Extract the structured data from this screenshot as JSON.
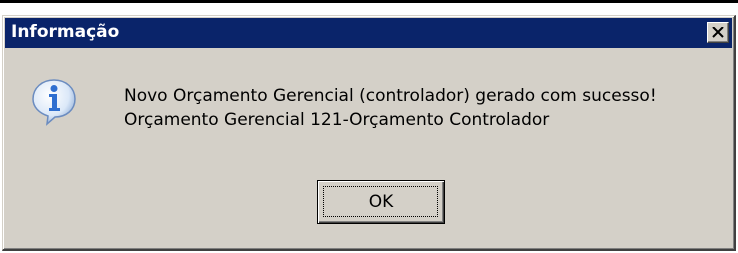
{
  "window": {
    "title": "Informação",
    "close_symbol": "✕"
  },
  "message": {
    "line1": "Novo Orçamento Gerencial (controlador) gerado com sucesso!",
    "line2": "Orçamento Gerencial 121-Orçamento Controlador"
  },
  "buttons": {
    "ok_label": "OK"
  },
  "icons": {
    "dialog_icon": "information-icon",
    "close_icon": "close-icon"
  },
  "colors": {
    "titlebar": "#0a246a",
    "dialog_face": "#d4d0c8",
    "icon_blue": "#2f6fd0"
  }
}
